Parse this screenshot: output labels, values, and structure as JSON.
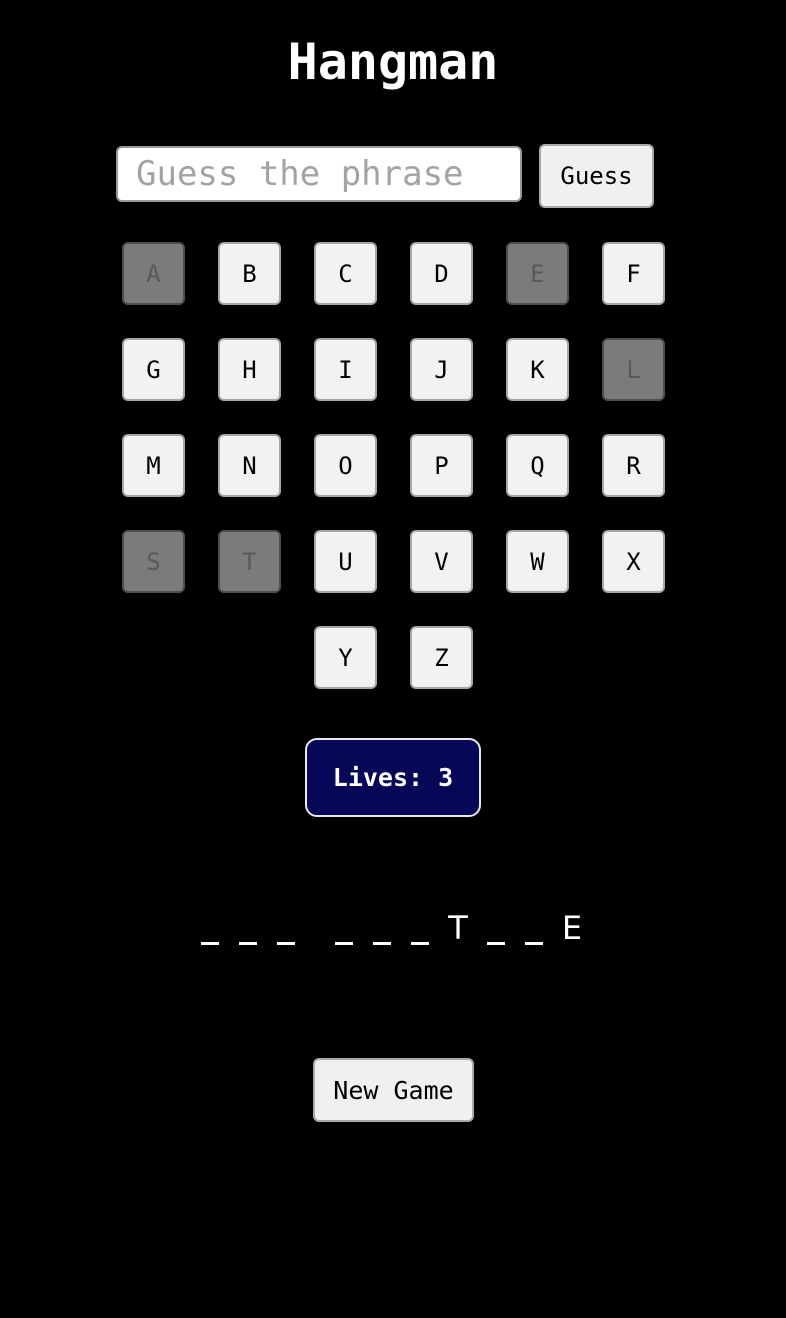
{
  "header": {
    "title": "Hangman"
  },
  "guess_form": {
    "input_value": "",
    "input_placeholder": "Guess the phrase",
    "button_label": "Guess"
  },
  "keyboard": {
    "letters": [
      {
        "label": "A",
        "used": true
      },
      {
        "label": "B",
        "used": false
      },
      {
        "label": "C",
        "used": false
      },
      {
        "label": "D",
        "used": false
      },
      {
        "label": "E",
        "used": true
      },
      {
        "label": "F",
        "used": false
      },
      {
        "label": "G",
        "used": false
      },
      {
        "label": "H",
        "used": false
      },
      {
        "label": "I",
        "used": false
      },
      {
        "label": "J",
        "used": false
      },
      {
        "label": "K",
        "used": false
      },
      {
        "label": "L",
        "used": true
      },
      {
        "label": "M",
        "used": false
      },
      {
        "label": "N",
        "used": false
      },
      {
        "label": "O",
        "used": false
      },
      {
        "label": "P",
        "used": false
      },
      {
        "label": "Q",
        "used": false
      },
      {
        "label": "R",
        "used": false
      },
      {
        "label": "S",
        "used": true
      },
      {
        "label": "T",
        "used": true
      },
      {
        "label": "U",
        "used": false
      },
      {
        "label": "V",
        "used": false
      },
      {
        "label": "W",
        "used": false
      },
      {
        "label": "X",
        "used": false
      },
      {
        "label": "Y",
        "used": false
      },
      {
        "label": "Z",
        "used": false
      }
    ]
  },
  "status": {
    "lives_label": "Lives: 3",
    "lives": 3
  },
  "phrase": {
    "words": [
      [
        "",
        "",
        ""
      ],
      [
        "",
        "",
        "",
        "T",
        "",
        "",
        "E"
      ]
    ]
  },
  "actions": {
    "new_game_label": "New Game"
  },
  "colors": {
    "background": "#000000",
    "lives_badge": "#070758",
    "key_active": "#f2f2f2",
    "key_used": "#7b7b7b"
  }
}
